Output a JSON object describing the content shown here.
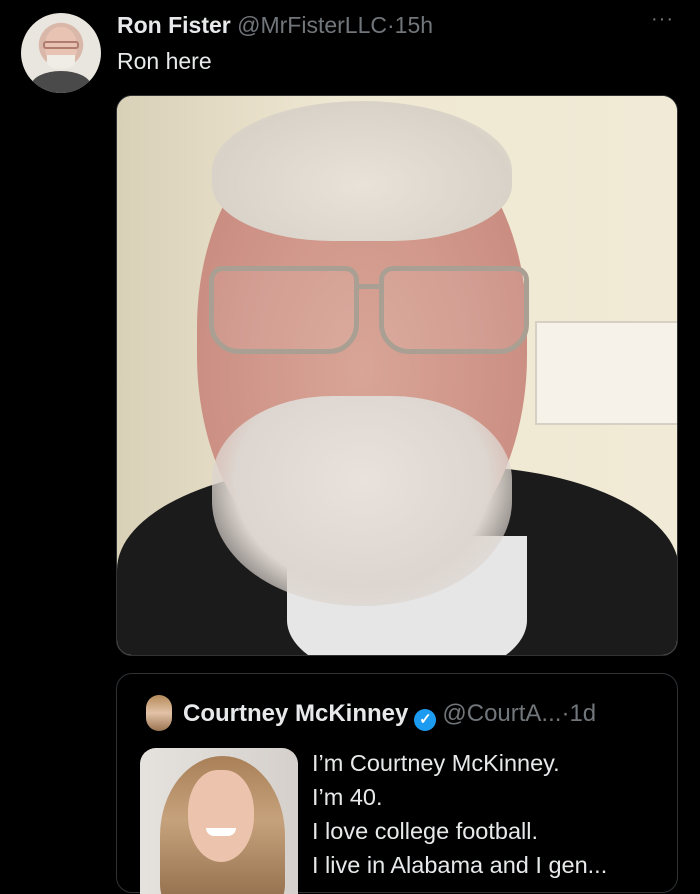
{
  "tweet": {
    "author_name": "Ron Fister",
    "author_handle": "@MrFisterLLC",
    "separator": "·",
    "time": "15h",
    "more_icon": "···",
    "text": "Ron here"
  },
  "quoted_tweet": {
    "author_name": "Courtney McKinney",
    "verified_icon": "✓",
    "author_handle": "@CourtA...",
    "separator": "·",
    "time": "1d",
    "lines": [
      "I’m Courtney McKinney.",
      "I’m 40.",
      "I love college football.",
      "I live in Alabama and I gen..."
    ]
  },
  "colors": {
    "background": "#000000",
    "primary_text": "#e7e9ea",
    "secondary_text": "#71767b",
    "verified": "#1d9bf0",
    "border": "#2f3336"
  }
}
